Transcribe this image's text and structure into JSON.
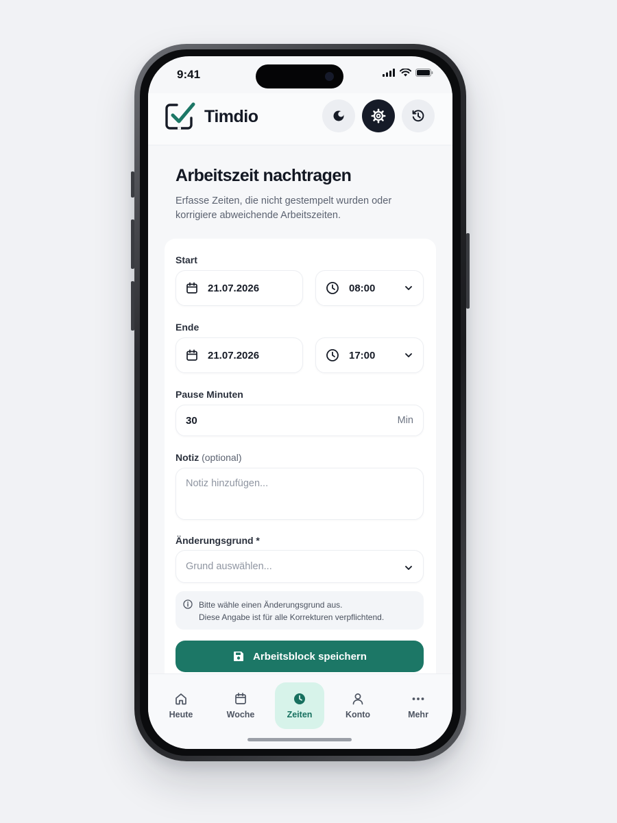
{
  "status_bar": {
    "time": "9:41"
  },
  "app": {
    "name": "Timdio"
  },
  "header_buttons": [
    {
      "name": "theme",
      "icon": "moon-icon"
    },
    {
      "name": "settings",
      "icon": "gear-icon"
    },
    {
      "name": "history",
      "icon": "history-icon"
    }
  ],
  "page": {
    "title": "Arbeitszeit nachtragen",
    "subtitle": "Erfasse Zeiten, die nicht gestempelt wurden oder korrigiere abweichende Arbeitszeiten."
  },
  "form": {
    "start": {
      "label": "Start",
      "date": "21.07.2026",
      "time": "08:00"
    },
    "end": {
      "label": "Ende",
      "date": "21.07.2026",
      "time": "17:00"
    },
    "pause": {
      "label": "Pause Minuten",
      "value": "30",
      "unit": "Min"
    },
    "note": {
      "label": "Notiz",
      "label_suffix": "(optional)",
      "placeholder": "Notiz hinzufügen..."
    },
    "reason": {
      "label": "Änderungsgrund *",
      "placeholder": "Grund auswählen..."
    },
    "info": {
      "line1": "Bitte wähle einen Änderungsgrund aus.",
      "line2": "Diese Angabe ist für alle Korrekturen verpflichtend."
    },
    "save_label": "Arbeitsblock speichern"
  },
  "nav": {
    "items": [
      {
        "label": "Heute",
        "icon": "home-icon"
      },
      {
        "label": "Woche",
        "icon": "calendar-icon"
      },
      {
        "label": "Zeiten",
        "icon": "clock-icon",
        "active": true
      },
      {
        "label": "Konto",
        "icon": "user-icon"
      },
      {
        "label": "Mehr",
        "icon": "more-icon"
      }
    ]
  },
  "colors": {
    "accent": "#1c7766",
    "accent_light": "#d7f3ea",
    "dark": "#161b28",
    "background": "#f6f7f9"
  }
}
